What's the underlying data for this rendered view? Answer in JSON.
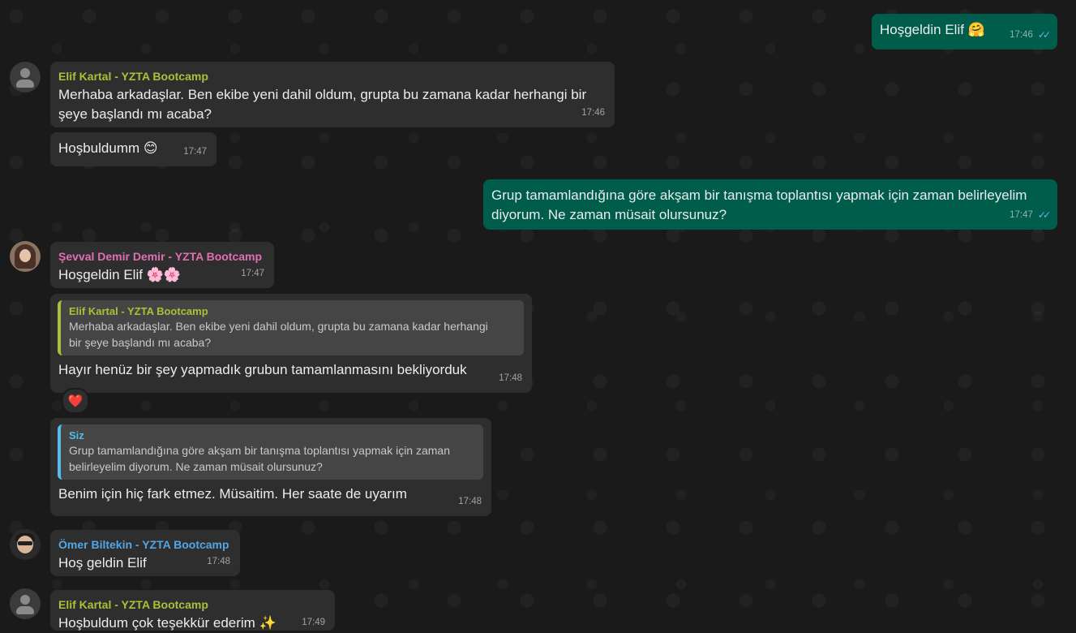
{
  "messages": {
    "m1": {
      "text": "Hoşgeldin Elif",
      "emoji": "🤗",
      "time": "17:46",
      "ticks": "✓✓"
    },
    "m2": {
      "sender": "Elif Kartal - YZTA Bootcamp",
      "line1": "Merhaba arkadaşlar. Ben ekibe yeni dahil oldum, grupta bu zamana kadar herhangi bir",
      "line2": "şeye başlandı mı acaba?",
      "time": "17:46"
    },
    "m3": {
      "text": "Hoşbuldumm",
      "emoji": "😊",
      "time": "17:47"
    },
    "m4": {
      "line1": "Grup tamamlandığına göre akşam bir tanışma toplantısı yapmak için zaman belirleyelim",
      "line2": "diyorum. Ne zaman müsait olursunuz?",
      "time": "17:47",
      "ticks": "✓✓"
    },
    "m5": {
      "sender": "Şevval Demir Demir - YZTA Bootcamp",
      "text": "Hoşgeldin Elif",
      "emoji": "🌸🌸",
      "time": "17:47"
    },
    "m6": {
      "quote_name": "Elif Kartal - YZTA Bootcamp",
      "quote_line1": "Merhaba arkadaşlar. Ben ekibe yeni dahil oldum, grupta bu zamana kadar herhangi",
      "quote_line2": "bir şeye başlandı mı acaba?",
      "text": "Hayır henüz bir şey yapmadık grubun tamamlanmasını bekliyorduk",
      "time": "17:48",
      "reaction": "❤️"
    },
    "m7": {
      "quote_name": "Siz",
      "quote_line1": "Grup tamamlandığına göre akşam bir tanışma toplantısı yapmak için zaman",
      "quote_line2": "belirleyelim diyorum. Ne zaman müsait olursunuz?",
      "text": "Benim için hiç fark etmez. Müsaitim. Her saate de uyarım",
      "time": "17:48"
    },
    "m8": {
      "sender": "Ömer Biltekin - YZTA Bootcamp",
      "text": "Hoş geldin Elif",
      "time": "17:48"
    },
    "m9": {
      "sender": "Elif Kartal - YZTA Bootcamp",
      "text": "Hoşbuldum çok teşekkür ederim",
      "emoji": "✨",
      "time": "17:49"
    }
  },
  "colors": {
    "elif": "#a9c13a",
    "sevval": "#e06fb3",
    "omer": "#53a6e6",
    "siz": "#53bdeb",
    "outgoing_bg": "#005c4b",
    "incoming_bg": "#2e2e2e"
  },
  "icons": {
    "read_receipt": "double-check-icon",
    "default_avatar": "default-avatar-icon"
  }
}
